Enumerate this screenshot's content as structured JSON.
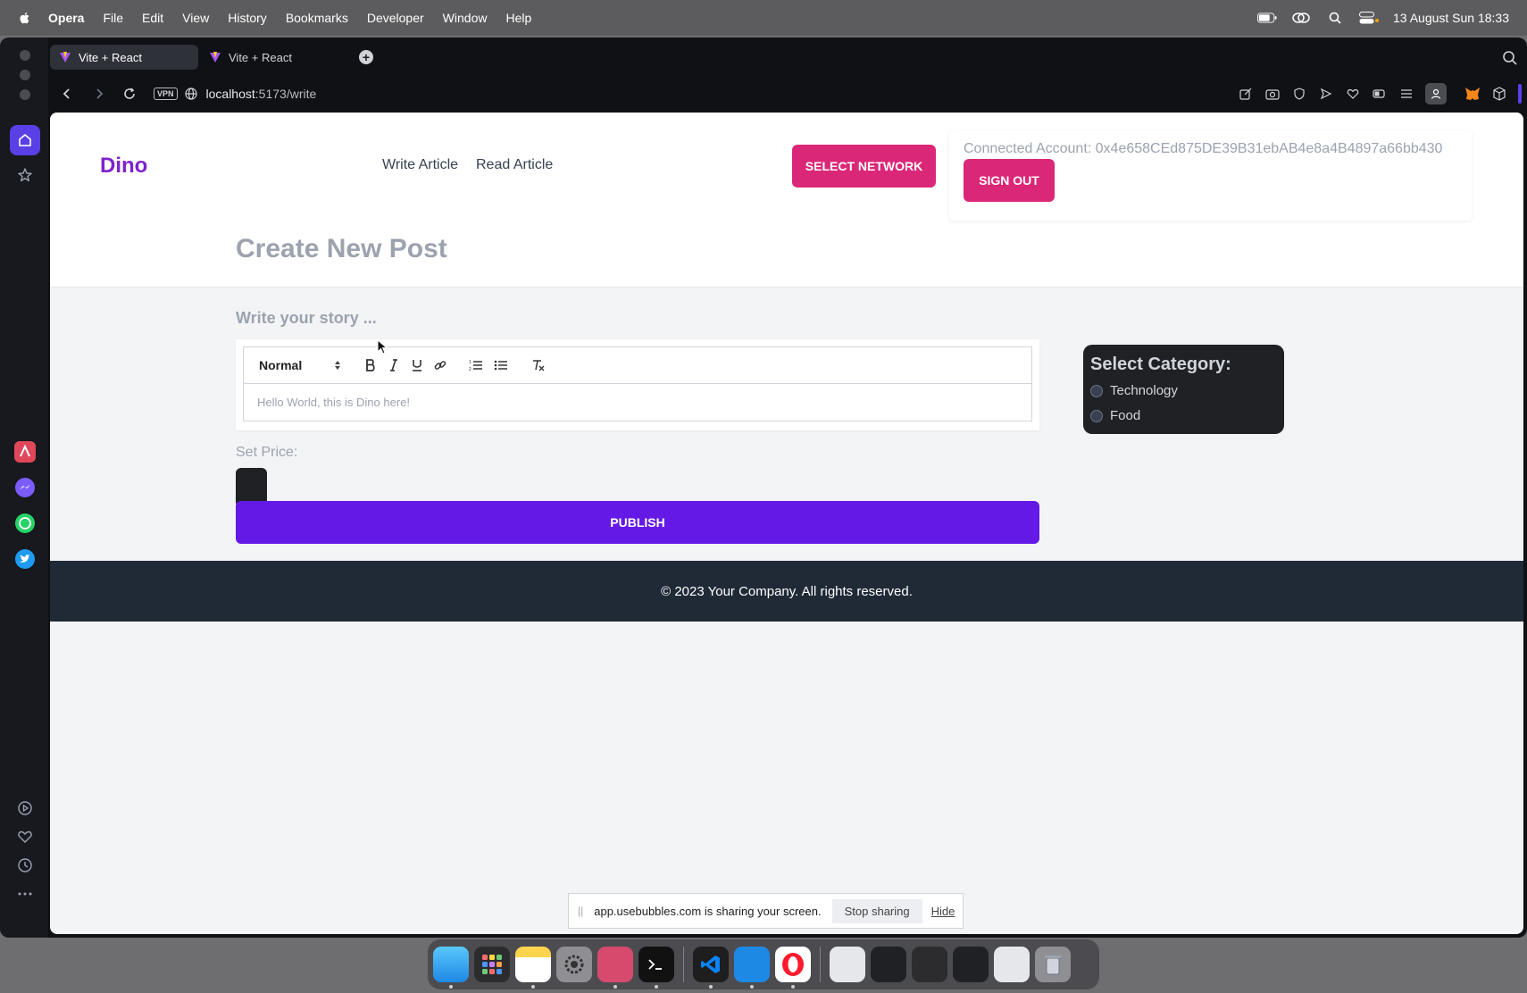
{
  "menubar": {
    "app": "Opera",
    "items": [
      "File",
      "Edit",
      "View",
      "History",
      "Bookmarks",
      "Developer",
      "Window",
      "Help"
    ],
    "clock": "13 August Sun  18:33"
  },
  "browser": {
    "tabs": [
      {
        "label": "Vite + React"
      },
      {
        "label": "Vite + React"
      }
    ],
    "vpn_label": "VPN",
    "url_host": "localhost",
    "url_path": ":5173/write"
  },
  "header": {
    "logo": "Dino",
    "nav": {
      "write": "Write Article",
      "read": "Read Article"
    },
    "select_network": "SELECT NETWORK",
    "connected_account": "Connected Account: 0x4e658CEd875DE39B31ebAB4e8a4B4897a66bb430",
    "sign_out": "SIGN OUT",
    "page_title": "Create New Post"
  },
  "editor": {
    "story_label": "Write your story ...",
    "format_select": "Normal",
    "placeholder": "Hello World, this is Dino here!"
  },
  "category": {
    "title": "Select Category:",
    "options": [
      "Technology",
      "Food"
    ]
  },
  "price": {
    "label": "Set Price:"
  },
  "publish": "PUBLISH",
  "footer": "© 2023 Your Company. All rights reserved.",
  "share_bar": {
    "message": "app.usebubbles.com is sharing your screen.",
    "stop": "Stop sharing",
    "hide": "Hide"
  },
  "colors": {
    "brand_purple": "#7e22ce",
    "pink": "#db2777",
    "publish_purple": "#6419e6",
    "footer": "#202a37"
  }
}
